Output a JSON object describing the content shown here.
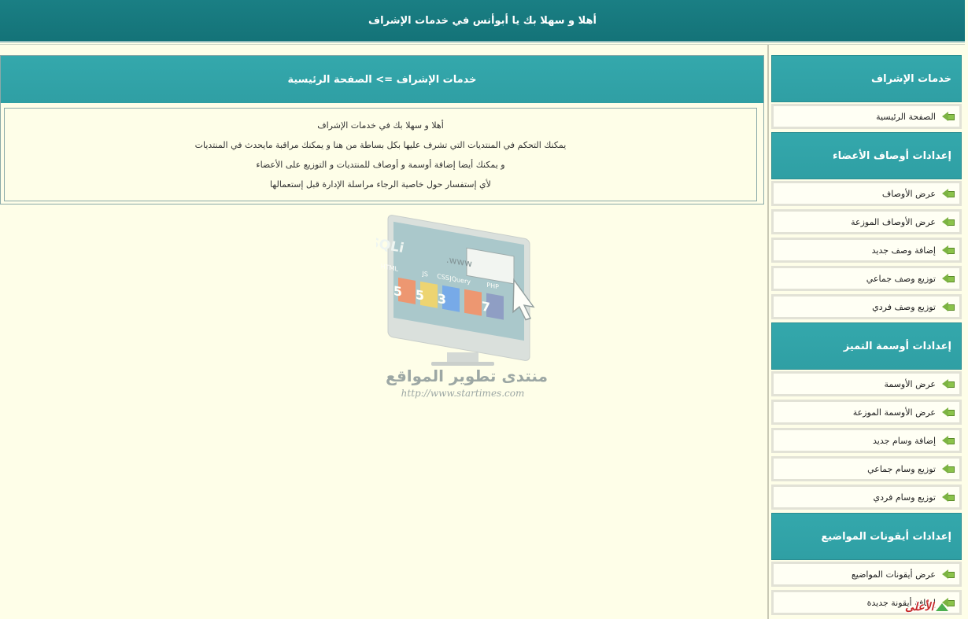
{
  "header": {
    "welcome": "أهلا و سهلا بك يا أبوأنس في خدمات الإشراف"
  },
  "main": {
    "breadcrumb": "خدمات الإشراف => الصفحة الرئيسية",
    "lines": [
      "أهلا و سهلا بك في خدمات الإشراف",
      "يمكنك التحكم في المنتديات التي تشرف عليها بكل بساطة من هنا و يمكنك مراقبة مايحدث في المنتديات",
      "و يمكنك أيضا إضافة أوسمة و أوصاف للمنتديات و التوزيع على الأعضاء",
      "لأي إستفسار حول خاصية الرجاء مراسلة الإدارة قبل إستعمالها"
    ]
  },
  "sidebar": {
    "sections": [
      {
        "title": "خدمات الإشراف",
        "items": [
          "الصفحة الرئيسية"
        ]
      },
      {
        "title": "إعدادات أوصاف الأعضاء",
        "items": [
          "عرض الأوصاف",
          "عرض الأوصاف الموزعة",
          "إضافة وصف جديد",
          "توزيع وصف جماعي",
          "توزيع وصف فردي"
        ]
      },
      {
        "title": "إعدادات أوسمة التميز",
        "items": [
          "عرض الأوسمة",
          "عرض الأوسمة الموزعة",
          "إضافة وسام جديد",
          "توزيع وسام جماعي",
          "توزيع وسام فردي"
        ]
      },
      {
        "title": "إعدادات أيقونات المواضيع",
        "items": [
          "عرض أيقونات المواضيع",
          "إضافة أيقونة جديدة"
        ]
      }
    ]
  },
  "watermark": {
    "site_name": "منتدى تطوير المواقع",
    "url": "http://www.startimes.com",
    "monitor_labels": [
      "MySQLi",
      "www.",
      "HTML",
      "JS",
      "CSS",
      "JQuery",
      "PHP"
    ],
    "badge_numbers": [
      "5",
      "5",
      "3",
      "7"
    ]
  },
  "back_to_top": {
    "label": "الأعلى"
  },
  "colors": {
    "teal_dark": "#147378",
    "teal": "#2f9fa4",
    "background": "#fefee8",
    "arrow_green": "#7cb342"
  }
}
